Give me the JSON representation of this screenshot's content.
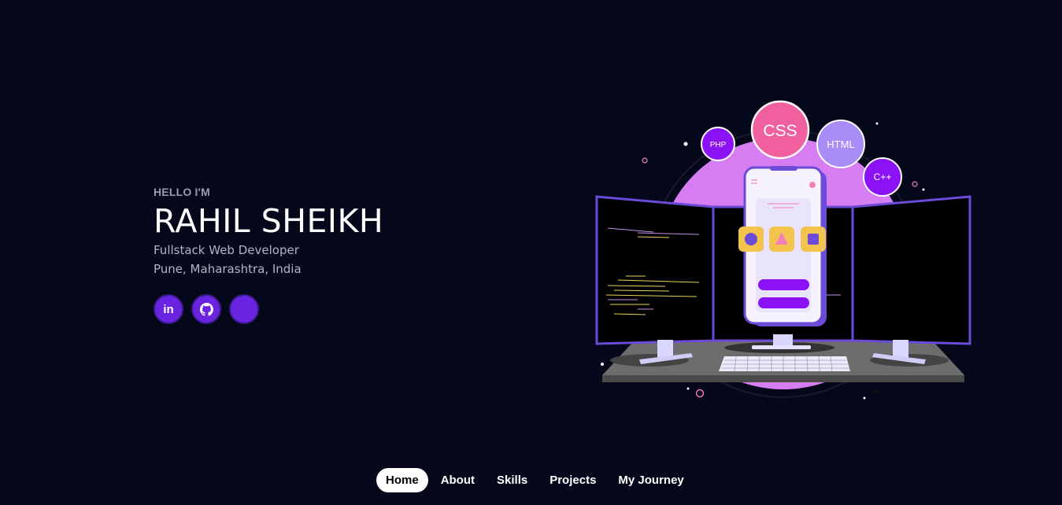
{
  "hero": {
    "greeting": "HELLO I'M",
    "name": "RAHIL SHEIKH",
    "role": "Fullstack Web Developer",
    "location": "Pune, Maharashtra, India"
  },
  "socials": [
    {
      "icon": "linkedin-icon",
      "text": "in"
    },
    {
      "icon": "github-icon"
    },
    {
      "icon": "blank-icon"
    }
  ],
  "illustration": {
    "bubbles": [
      "PHP",
      "CSS",
      "HTML",
      "C++"
    ],
    "colors": {
      "accent": "#8a12f5",
      "pink": "#f0609e",
      "lavender": "#a98cf5",
      "violet_bg": "#d77df2",
      "yellow": "#f3c44d"
    }
  },
  "nav": {
    "items": [
      "Home",
      "About",
      "Skills",
      "Projects",
      "My Journey"
    ],
    "active": "Home"
  },
  "theme": {
    "background": "#05071a",
    "social_bg": "#6a24e0"
  }
}
